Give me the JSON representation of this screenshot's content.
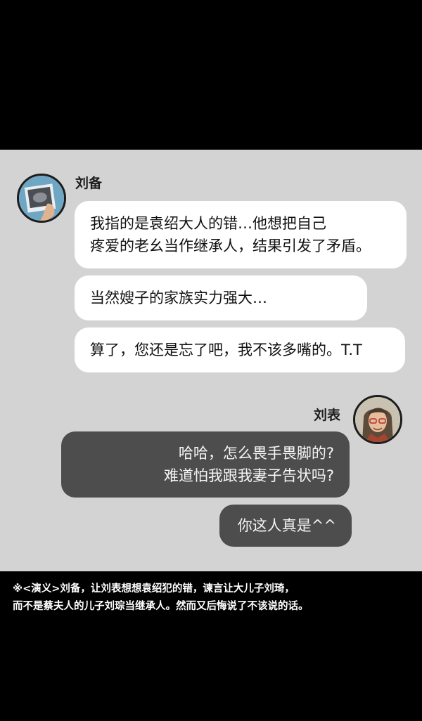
{
  "messages": [
    {
      "speaker": "刘备",
      "lines": [
        "我指的是袁绍大人的错…他想把自己",
        "疼爱的老幺当作继承人，结果引发了矛盾。"
      ]
    },
    {
      "lines": [
        "当然嫂子的家族实力强大…"
      ]
    },
    {
      "lines": [
        "算了，您还是忘了吧，我不该多嘴的。T.T"
      ]
    },
    {
      "speaker": "刘表",
      "lines": [
        "哈哈，怎么畏手畏脚的?",
        "难道怕我跟我妻子告状吗?"
      ]
    },
    {
      "lines": [
        "你这人真是^^"
      ]
    }
  ],
  "note": {
    "lines": [
      "※<演义>刘备，让刘表想想袁绍犯的错，谏言让大儿子刘琦，",
      "而不是蔡夫人的儿子刘琮当继承人。然而又后悔说了不该说的话。"
    ]
  },
  "colors": {
    "chat_bg": "#d3d3d3",
    "dark_bubble": "#4d4d4d",
    "white_bubble": "#ffffff"
  }
}
